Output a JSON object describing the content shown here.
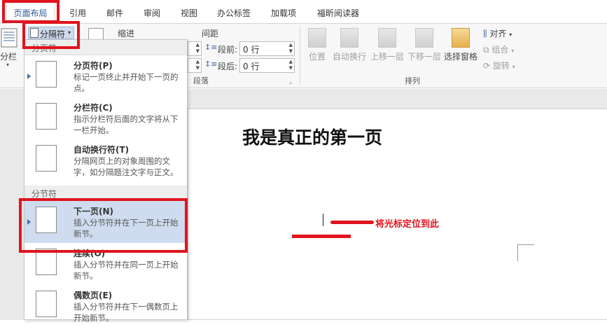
{
  "tabs": [
    "页面布局",
    "引用",
    "邮件",
    "审阅",
    "视图",
    "办公标签",
    "加载项",
    "福昕阅读器"
  ],
  "ribbon": {
    "columns_label": "分栏",
    "breaks_label": "分隔符",
    "indent_label": "缩进",
    "spacing_label": "间距",
    "before_label": "段前:",
    "before_value": "0 行",
    "after_label": "段后:",
    "after_value": "0 行",
    "paragraph_group": "段落",
    "arrange_group": "排列",
    "position_label": "位置",
    "wrap_label": "自动换行",
    "bring_forward_label": "上移一层",
    "send_backward_label": "下移一层",
    "selection_pane_label": "选择窗格",
    "align_label": "对齐",
    "group_label": "组合",
    "rotate_label": "旋转"
  },
  "dropdown": {
    "page_breaks_header": "分页符",
    "section_breaks_header": "分节符",
    "items": [
      {
        "title": "分页符(P)",
        "desc": "标记一页终止并开始下一页的点。"
      },
      {
        "title": "分栏符(C)",
        "desc": "指示分栏符后面的文字将从下一栏开始。"
      },
      {
        "title": "自动换行符(T)",
        "desc": "分隔网页上的对象周围的文字，如分隔题注文字与正文。"
      },
      {
        "title": "下一页(N)",
        "desc": "插入分节符并在下一页上开始新节。"
      },
      {
        "title": "连续(O)",
        "desc": "插入分节符并在同一页上开始新节。"
      },
      {
        "title": "偶数页(E)",
        "desc": "插入分节符并在下一偶数页上开始新节。"
      }
    ]
  },
  "document": {
    "heading": "我是真正的第一页",
    "annotation": "将光标定位到此"
  },
  "colors": {
    "annotation_red": "#e0141e",
    "highlight": "#cfdcef",
    "accent": "#2b579a"
  }
}
